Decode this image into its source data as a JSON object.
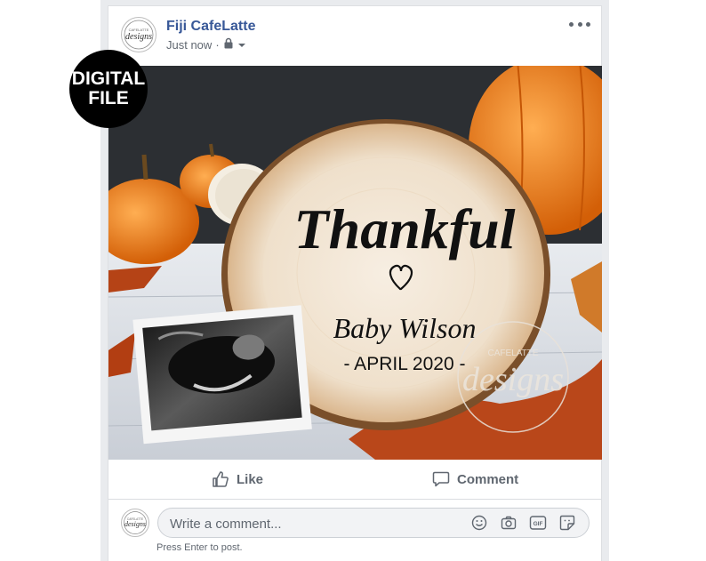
{
  "post": {
    "page_name": "Fiji CafeLatte",
    "timestamp": "Just now",
    "separator": "·",
    "privacy_icon": "lock-icon"
  },
  "badge": {
    "line1": "DIGITAL",
    "line2": "FILE"
  },
  "image": {
    "headline": "Thankful",
    "name": "Baby Wilson",
    "date": "- APRIL 2020 -",
    "watermark_small": "CAFELATTE",
    "watermark_large": "designs"
  },
  "logo": {
    "top": "CAFELATTE",
    "main": "designs"
  },
  "actions": {
    "like": "Like",
    "comment": "Comment"
  },
  "comment": {
    "placeholder": "Write a comment...",
    "hint": "Press Enter to post.",
    "icons": [
      "emoji-icon",
      "camera-icon",
      "gif-icon",
      "sticker-icon"
    ]
  },
  "colors": {
    "link": "#385898",
    "text_secondary": "#606770",
    "background": "#e9ebee",
    "pumpkin": "#ef7a17"
  }
}
